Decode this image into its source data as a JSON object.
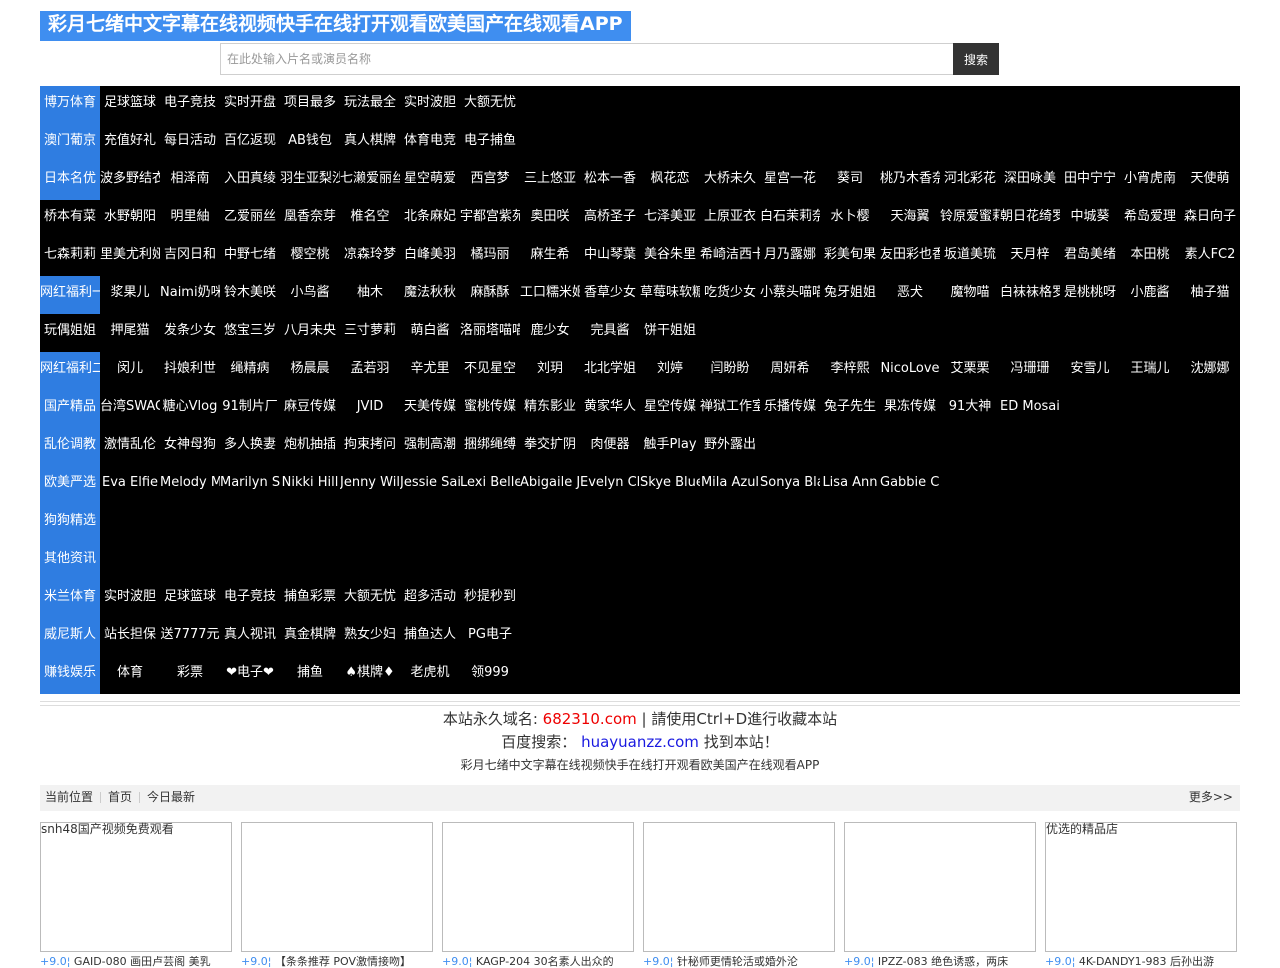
{
  "site": {
    "title": "彩月七绪中文字幕在线视频快手在线打开观看欧美国产在线观看APP"
  },
  "search": {
    "placeholder": "在此处输入片名或演员名称",
    "button": "搜索"
  },
  "nav_rows": [
    {
      "category": "博万体育",
      "links": [
        "足球篮球",
        "电子竞技",
        "实时开盘",
        "项目最多",
        "玩法最全",
        "实时波胆",
        "大额无忧"
      ]
    },
    {
      "category": "澳门葡京",
      "links": [
        "充值好礼",
        "每日活动",
        "百亿返现",
        "AB钱包",
        "真人棋牌",
        "体育电竞",
        "电子捕鱼"
      ]
    },
    {
      "category": "日本名优",
      "links": [
        "波多野结衣",
        "相泽南",
        "入田真绫",
        "羽生亚梨沙",
        "七濑爱丽丝",
        "星空萌爱",
        "西宫梦",
        "三上悠亚",
        "松本一香",
        "枫花恋",
        "大桥未久",
        "星宫一花",
        "葵司",
        "桃乃木香奈",
        "河北彩花",
        "深田咏美",
        "田中宁宁",
        "小宵虎南",
        "天使萌"
      ]
    },
    {
      "category": "",
      "links": [
        "桥本有菜",
        "水野朝阳",
        "明里紬",
        "乙爱丽丝",
        "凰香奈芽",
        "椎名空",
        "北条麻妃",
        "宇都宫紫苑",
        "奥田咲",
        "高桥圣子",
        "七泽美亚",
        "上原亚衣",
        "白石茉莉奈",
        "水卜樱",
        "天海翼",
        "铃原爱蜜莉",
        "朝日花绮罗",
        "中城葵",
        "希岛爱理",
        "森日向子"
      ]
    },
    {
      "category": "",
      "links": [
        "七森莉莉",
        "里美尤利娅",
        "吉冈日和",
        "中野七绪",
        "樱空桃",
        "凉森玲梦",
        "白峰美羽",
        "橘玛丽",
        "麻生希",
        "中山琴葉",
        "美谷朱里",
        "希崎洁西卡",
        "月乃露娜",
        "彩美旬果",
        "友田彩也香",
        "坂道美琉",
        "天月梓",
        "君岛美绪",
        "本田桃",
        "素人FC2"
      ]
    },
    {
      "category": "网红福利一",
      "links": [
        "浆果儿",
        "Naimi奶咪",
        "铃木美咲",
        "小鸟酱",
        "柚木",
        "魔法秋秋",
        "麻酥酥",
        "工口糯米姬",
        "香草少女",
        "草莓味软糖",
        "吃货少女",
        "小蔡头喵喵",
        "兔牙姐姐",
        "恶犬",
        "魔物喵",
        "白袜袜格罗",
        "是桃桃呀",
        "小鹿酱",
        "柚子猫"
      ]
    },
    {
      "category": "",
      "links": [
        "玩偶姐姐",
        "押尾猫",
        "发条少女",
        "悠宝三岁",
        "八月未央",
        "三寸萝莉",
        "萌白酱",
        "洛丽塔喵喵",
        "鹿少女",
        "完具酱",
        "饼干姐姐"
      ]
    },
    {
      "category": "网红福利二",
      "links": [
        "闵儿",
        "抖娘利世",
        "绳精病",
        "杨晨晨",
        "孟若羽",
        "辛尤里",
        "不见星空",
        "刘玥",
        "北北学姐",
        "刘婷",
        "闫盼盼",
        "周妍希",
        "李梓熙",
        "NicoLove",
        "艾栗栗",
        "冯珊珊",
        "安雪儿",
        "王瑞儿",
        "沈娜娜"
      ]
    },
    {
      "category": "国产精品",
      "links": [
        "台湾SWAG",
        "糖心Vlog",
        "91制片厂",
        "麻豆传媒",
        "JVID",
        "天美传媒",
        "蜜桃传媒",
        "精东影业",
        "黄家华人",
        "星空传媒",
        "禅狱工作室",
        "乐播传媒",
        "兔子先生",
        "果冻传媒",
        "91大神",
        "ED Mosaic"
      ]
    },
    {
      "category": "乱伦调教",
      "links": [
        "激情乱伦",
        "女神母狗",
        "多人换妻",
        "炮机抽插",
        "拘束拷问",
        "强制高潮",
        "捆绑绳缚",
        "拳交扩阴",
        "肉便器",
        "触手Play",
        "野外露出"
      ]
    },
    {
      "category": "欧美严选",
      "links": [
        "Eva Elfie",
        "Melody Marks",
        "Marilyn Sugar",
        "Nikki Hill",
        "Jenny Wild",
        "Jessie Saint",
        "Lexi Belle",
        "Abigaile Johnson",
        "Evelyn Claire",
        "Skye Blue",
        "Mila Azul",
        "Sonya Blaze",
        "Lisa Ann",
        "Gabbie Carter"
      ]
    },
    {
      "category": "狗狗精选",
      "links": []
    },
    {
      "category": "其他资讯",
      "links": []
    },
    {
      "category": "米兰体育",
      "links": [
        "实时波胆",
        "足球篮球",
        "电子竞技",
        "捕鱼彩票",
        "大额无忧",
        "超多活动",
        "秒提秒到"
      ]
    },
    {
      "category": "威尼斯人",
      "links": [
        "站长担保",
        "送7777元",
        "真人视讯",
        "真金棋牌",
        "熟女少妇",
        "捕鱼达人",
        "PG电子"
      ]
    },
    {
      "category": "赚钱娱乐",
      "links": [
        "体育",
        "彩票",
        "❤电子❤",
        "捕鱼",
        "♠棋牌♦",
        "老虎机",
        "领999"
      ]
    }
  ],
  "notice": {
    "line1_prefix": "本站永久域名: ",
    "line1_domain": "682310.com",
    "line1_suffix": " | 請使用Ctrl+D進行收藏本站",
    "line2_prefix": "百度搜索： ",
    "line2_domain": "huayuanzz.com",
    "line2_suffix": " 找到本站！",
    "line3": "彩月七绪中文字幕在线视频快手在线打开观看欧美国产在线观看APP"
  },
  "breadcrumb": {
    "current": "当前位置",
    "home": "首页",
    "today": "今日最新",
    "more": "更多>>"
  },
  "thumbs": [
    {
      "alt": "snh48国产视频免费观看",
      "score": "+9.0¦",
      "title": "GAID-080 画田卢芸阁 美乳"
    },
    {
      "alt": "",
      "score": "+9.0¦",
      "title": "【条条推荐 POV激情接吻】"
    },
    {
      "alt": "",
      "score": "+9.0¦",
      "title": "KAGP-204 30名素人出众的"
    },
    {
      "alt": "",
      "score": "+9.0¦",
      "title": "针秘师更情轮活或婚外沦"
    },
    {
      "alt": "",
      "score": "+9.0¦",
      "title": "IPZZ-083 绝色诱惑，两床"
    },
    {
      "alt": "优选的精品店",
      "score": "+9.0¦",
      "title": "4K-DANDY1-983 后孙出游"
    }
  ]
}
